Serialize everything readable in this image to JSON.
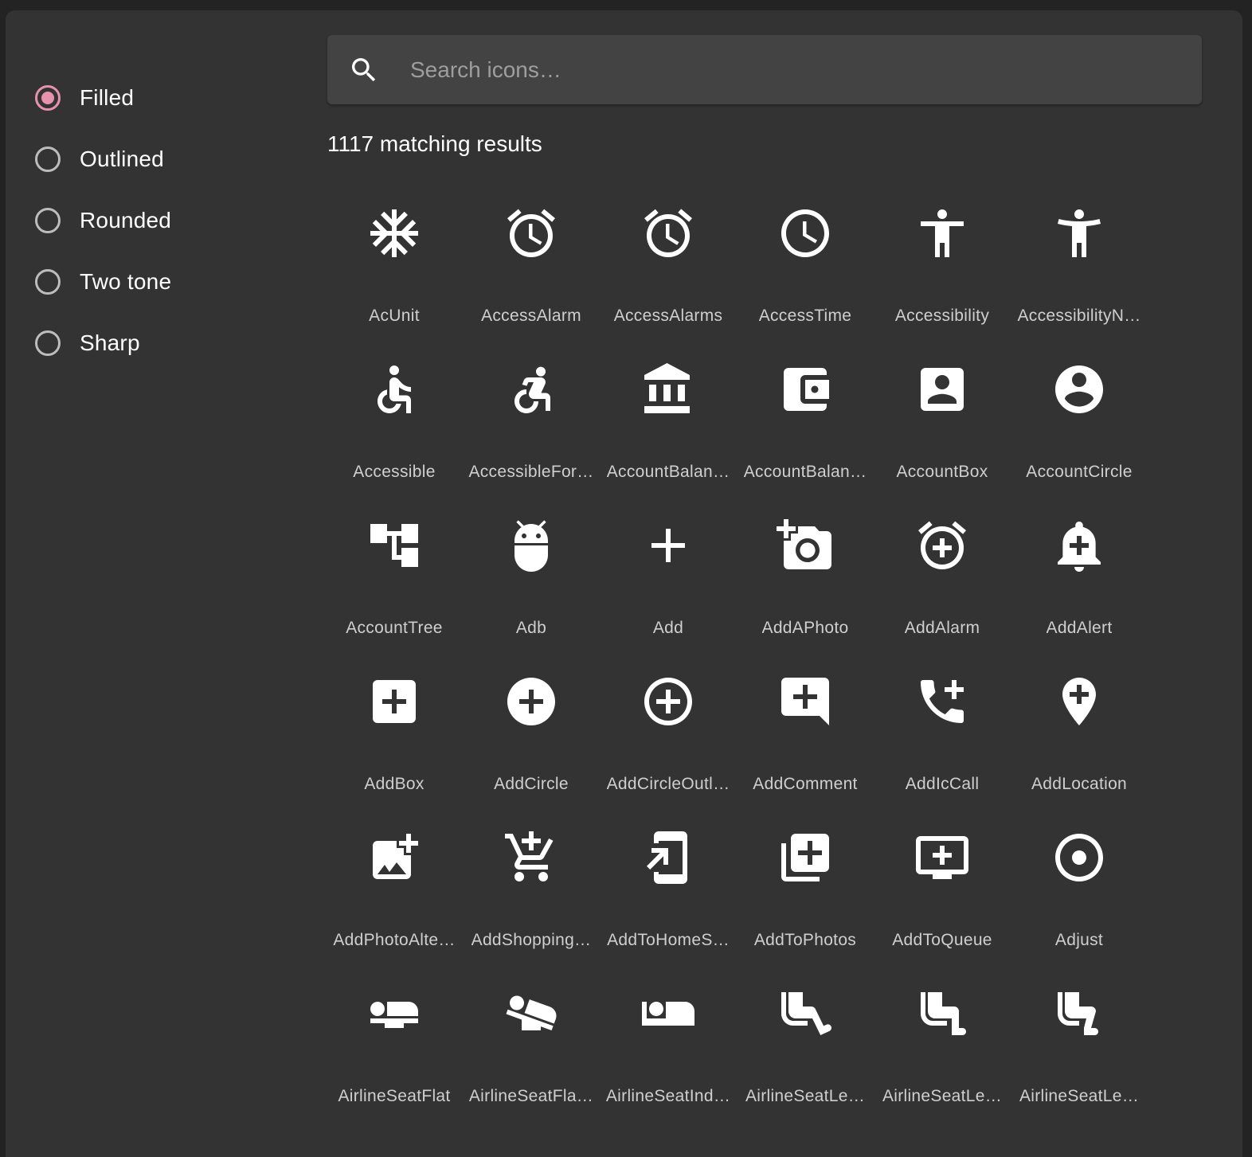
{
  "theme_options": {
    "selected": "Filled",
    "accent_color": "#e891ad",
    "items": [
      {
        "label": "Filled",
        "checked": true
      },
      {
        "label": "Outlined",
        "checked": false
      },
      {
        "label": "Rounded",
        "checked": false
      },
      {
        "label": "Two tone",
        "checked": false
      },
      {
        "label": "Sharp",
        "checked": false
      }
    ]
  },
  "search": {
    "placeholder": "Search icons…",
    "value": "",
    "icon": "search-icon"
  },
  "results": {
    "count_text": "1117 matching results"
  },
  "icons": [
    {
      "label": "AcUnit",
      "icon": "ac-unit"
    },
    {
      "label": "AccessAlarm",
      "icon": "access-alarm"
    },
    {
      "label": "AccessAlarms",
      "icon": "access-alarms"
    },
    {
      "label": "AccessTime",
      "icon": "access-time"
    },
    {
      "label": "Accessibility",
      "icon": "accessibility"
    },
    {
      "label": "AccessibilityN…",
      "icon": "accessibility-new"
    },
    {
      "label": "Accessible",
      "icon": "accessible"
    },
    {
      "label": "AccessibleFor…",
      "icon": "accessible-forward"
    },
    {
      "label": "AccountBalan…",
      "icon": "account-balance"
    },
    {
      "label": "AccountBalan…",
      "icon": "account-balance-wallet"
    },
    {
      "label": "AccountBox",
      "icon": "account-box"
    },
    {
      "label": "AccountCircle",
      "icon": "account-circle"
    },
    {
      "label": "AccountTree",
      "icon": "account-tree"
    },
    {
      "label": "Adb",
      "icon": "adb"
    },
    {
      "label": "Add",
      "icon": "add"
    },
    {
      "label": "AddAPhoto",
      "icon": "add-a-photo"
    },
    {
      "label": "AddAlarm",
      "icon": "add-alarm"
    },
    {
      "label": "AddAlert",
      "icon": "add-alert"
    },
    {
      "label": "AddBox",
      "icon": "add-box"
    },
    {
      "label": "AddCircle",
      "icon": "add-circle"
    },
    {
      "label": "AddCircleOutl…",
      "icon": "add-circle-outline"
    },
    {
      "label": "AddComment",
      "icon": "add-comment"
    },
    {
      "label": "AddIcCall",
      "icon": "add-ic-call"
    },
    {
      "label": "AddLocation",
      "icon": "add-location"
    },
    {
      "label": "AddPhotoAlte…",
      "icon": "add-photo-alternate"
    },
    {
      "label": "AddShopping…",
      "icon": "add-shopping-cart"
    },
    {
      "label": "AddToHomeS…",
      "icon": "add-to-home-screen"
    },
    {
      "label": "AddToPhotos",
      "icon": "add-to-photos"
    },
    {
      "label": "AddToQueue",
      "icon": "add-to-queue"
    },
    {
      "label": "Adjust",
      "icon": "adjust"
    },
    {
      "label": "AirlineSeatFlat",
      "icon": "airline-seat-flat"
    },
    {
      "label": "AirlineSeatFla…",
      "icon": "airline-seat-flat-angled"
    },
    {
      "label": "AirlineSeatInd…",
      "icon": "airline-seat-individual-suite"
    },
    {
      "label": "AirlineSeatLe…",
      "icon": "airline-seat-legroom-extra"
    },
    {
      "label": "AirlineSeatLe…",
      "icon": "airline-seat-legroom-normal"
    },
    {
      "label": "AirlineSeatLe…",
      "icon": "airline-seat-legroom-reduced"
    }
  ]
}
